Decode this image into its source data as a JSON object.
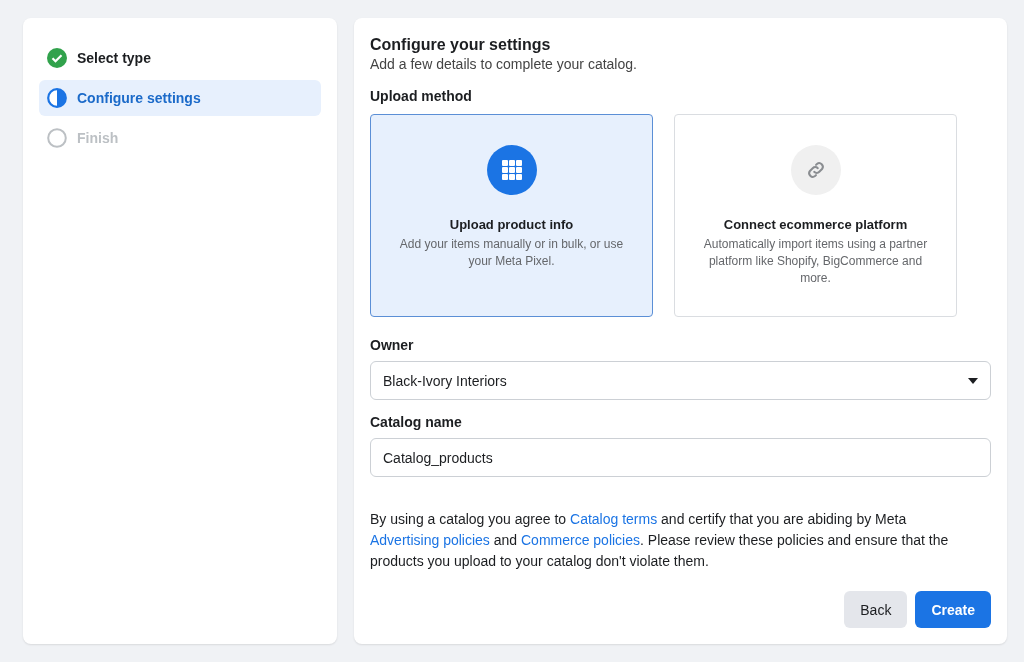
{
  "steps": [
    {
      "label": "Select type",
      "kind": "done",
      "selected": false
    },
    {
      "label": "Configure settings",
      "kind": "current",
      "selected": true
    },
    {
      "label": "Finish",
      "kind": "pending",
      "selected": false
    }
  ],
  "form": {
    "title": "Configure your settings",
    "subtitle": "Add a few details to complete your catalog.",
    "upload_method": {
      "label": "Upload method",
      "options": [
        {
          "kind": "upload",
          "title": "Upload product info",
          "description": "Add your items manually or in bulk, or use your Meta Pixel.",
          "selected": true
        },
        {
          "kind": "connect",
          "title": "Connect ecommerce platform",
          "description": "Automatically import items using a partner platform like Shopify, BigCommerce and more.",
          "selected": false
        }
      ]
    },
    "owner": {
      "label": "Owner",
      "value": "Black-Ivory Interiors"
    },
    "catalog_name": {
      "label": "Catalog name",
      "value": "Catalog_products"
    },
    "agreement": [
      {
        "kind": "text",
        "text": "By using a catalog you agree to "
      },
      {
        "kind": "link",
        "text": "Catalog terms"
      },
      {
        "kind": "text",
        "text": " and certify that you are abiding by Meta "
      },
      {
        "kind": "link",
        "text": "Advertising policies"
      },
      {
        "kind": "text",
        "text": " and "
      },
      {
        "kind": "link",
        "text": "Commerce policies"
      },
      {
        "kind": "text",
        "text": ". Please review these policies and ensure that the products you upload to your catalog don't violate them."
      }
    ],
    "buttons": [
      {
        "label": "Back",
        "kind": "secondary"
      },
      {
        "label": "Create",
        "kind": "primary"
      }
    ]
  }
}
